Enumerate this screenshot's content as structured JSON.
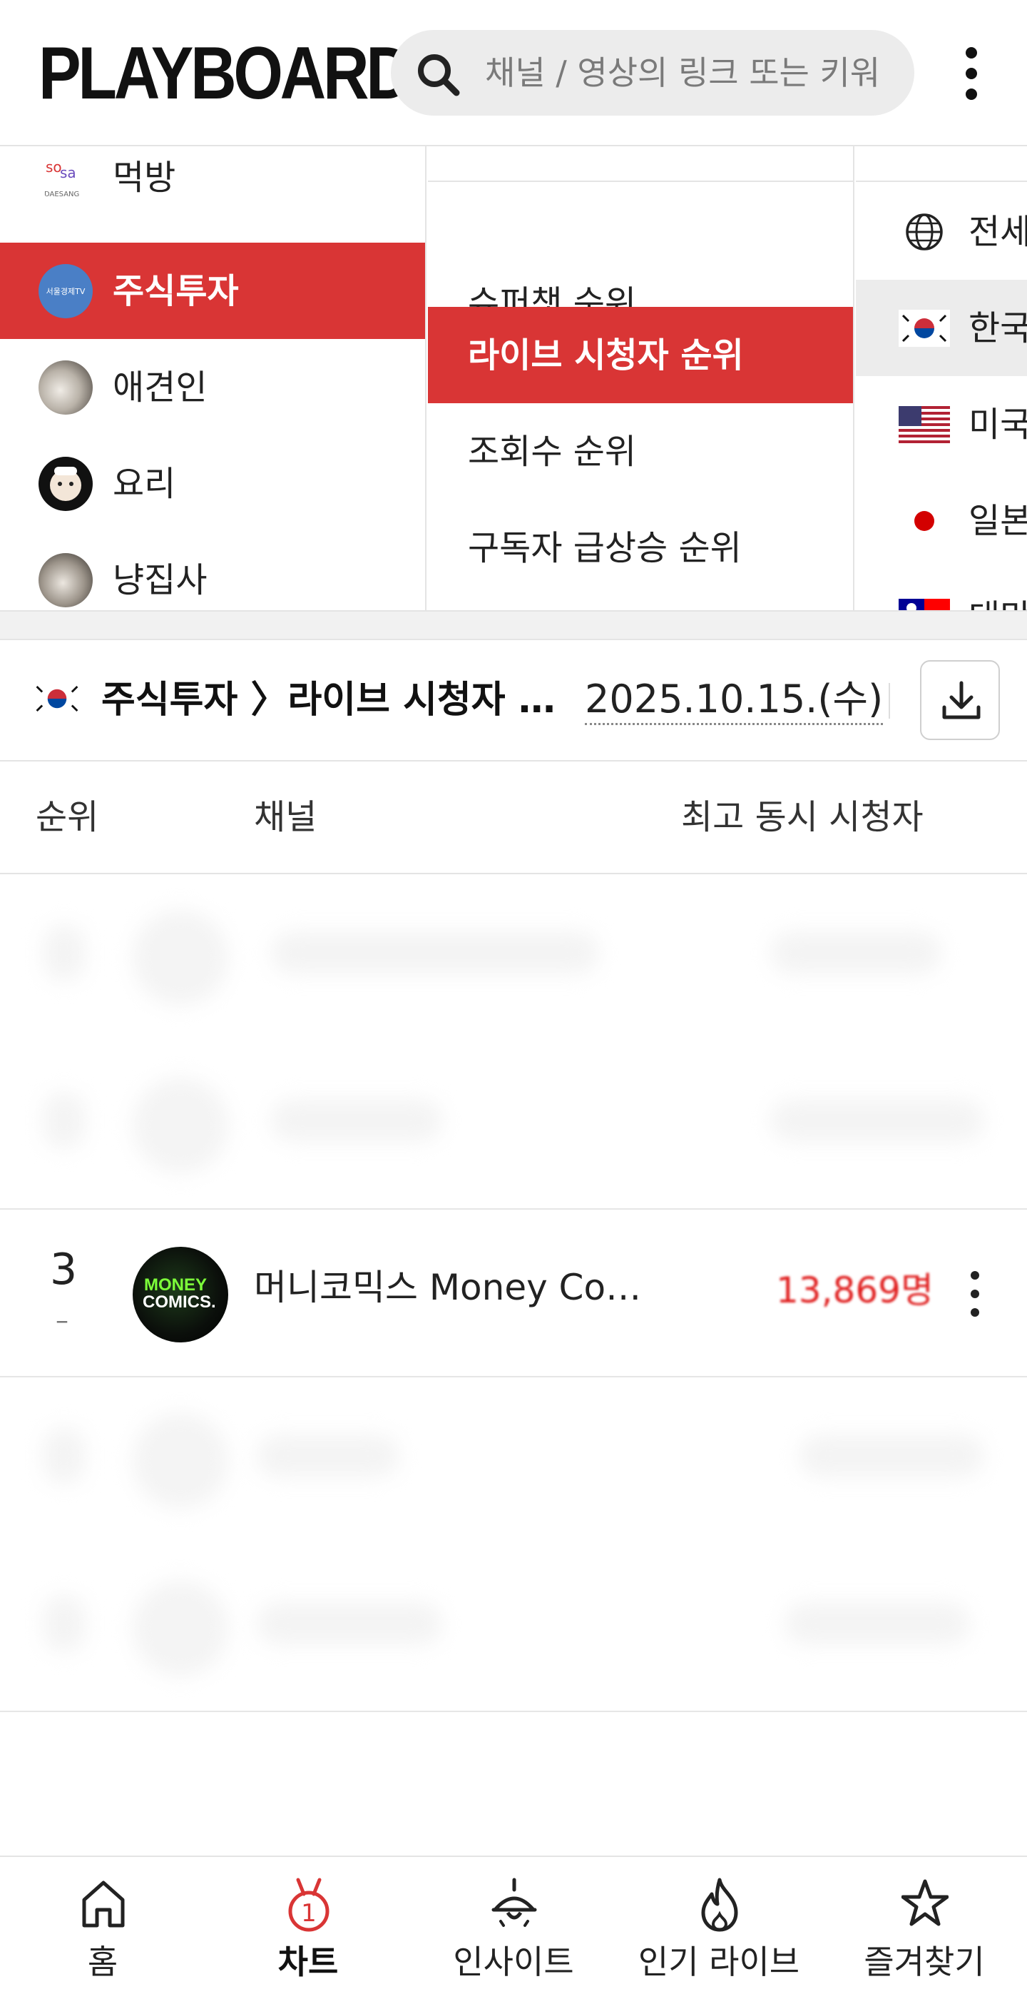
{
  "app": {
    "logo": "PLAYBOARD"
  },
  "search": {
    "placeholder": "채널 / 영상의 링크 또는 키워"
  },
  "categories": [
    {
      "label": "먹방",
      "avatar_text": "DAESANG"
    },
    {
      "label": "주식투자",
      "avatar_text": "서울경제TV",
      "active": true
    },
    {
      "label": "애견인"
    },
    {
      "label": "요리"
    },
    {
      "label": "냥집사"
    }
  ],
  "ranking_types": [
    {
      "label": "슈퍼챗 순위"
    },
    {
      "label": "라이브 시청자 순위",
      "active": true
    },
    {
      "label": "조회수 순위"
    },
    {
      "label": "구독자 급상승 순위"
    }
  ],
  "countries": [
    {
      "label": "전세",
      "icon": "globe-icon"
    },
    {
      "label": "한국",
      "icon": "korea-flag-icon",
      "active": true
    },
    {
      "label": "미국",
      "icon": "us-flag-icon"
    },
    {
      "label": "일본",
      "icon": "japan-flag-icon"
    },
    {
      "label": "대만",
      "icon": "taiwan-flag-icon"
    }
  ],
  "title_row": {
    "breadcrumb": "주식투자 〉라이브 시청자 …",
    "date": "2025.10.15.(수)"
  },
  "table": {
    "headers": {
      "rank": "순위",
      "channel": "채널",
      "viewers": "최고 동시 시청자"
    },
    "rows": [
      {
        "rank": "3",
        "change": "–",
        "channel": "머니코믹스 Money Com…",
        "viewers": "13,869명",
        "avatar_text_1": "MONEY",
        "avatar_text_2": "COMICS."
      }
    ]
  },
  "bottom_nav": [
    {
      "label": "홈",
      "icon": "home-icon"
    },
    {
      "label": "차트",
      "icon": "chart-medal-icon",
      "active": true,
      "badge": "1"
    },
    {
      "label": "인사이트",
      "icon": "insight-lamp-icon"
    },
    {
      "label": "인기 라이브",
      "icon": "fire-icon"
    },
    {
      "label": "즐겨찾기",
      "icon": "star-icon"
    }
  ],
  "colors": {
    "accent": "#d93535",
    "viewers": "#e02020"
  }
}
